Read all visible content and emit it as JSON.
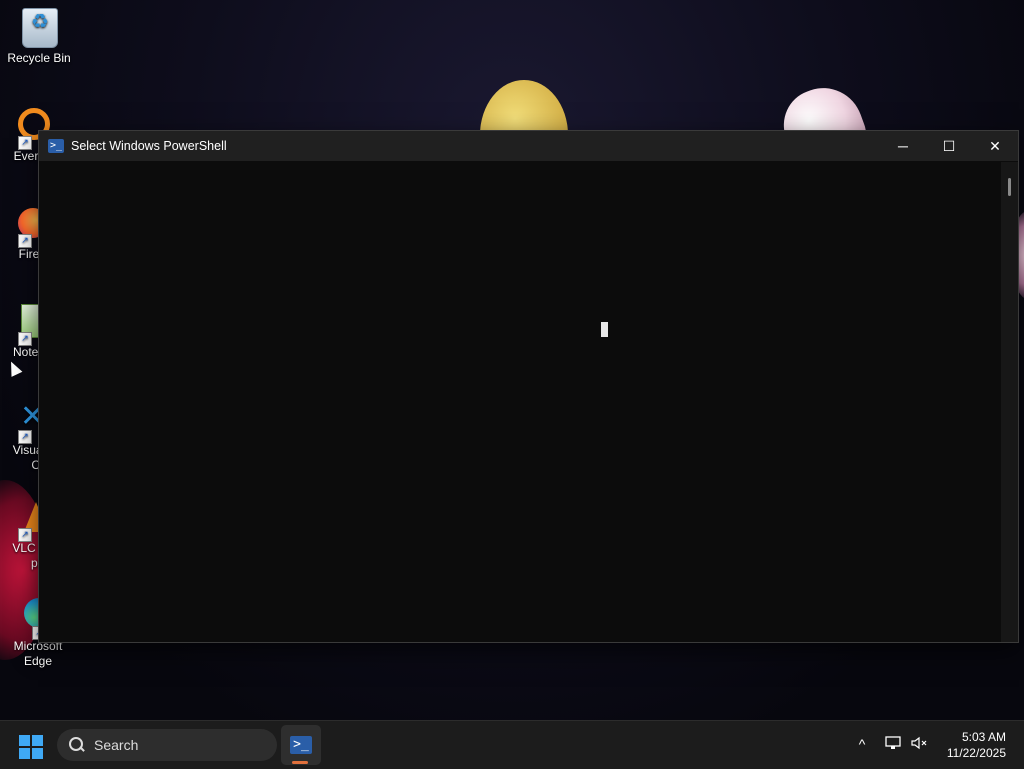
{
  "desktop": {
    "icons": [
      {
        "label": "Recycle Bin",
        "icon": "recycle-bin-icon"
      },
      {
        "label": "Every",
        "icon": "everything-icon"
      },
      {
        "label": "Fire",
        "icon": "firefox-icon"
      },
      {
        "label": "Notep",
        "icon": "notepad-plus-plus-icon"
      },
      {
        "label": "Visual",
        "label2": "Co",
        "icon": "vscode-icon"
      },
      {
        "label": "VLC n",
        "label2": "pla",
        "icon": "vlc-icon"
      },
      {
        "label": "Microsoft",
        "label2": "Edge",
        "icon": "edge-icon"
      }
    ]
  },
  "window": {
    "title": "Select Windows PowerShell",
    "buttons": {
      "minimize": "─",
      "maximize": "☐",
      "close": "✕"
    }
  },
  "taskbar": {
    "search_placeholder": "Search",
    "apps": [
      {
        "name": "Windows PowerShell",
        "active": true
      }
    ],
    "time": "5:03 AM",
    "date": "11/22/2025",
    "tray": {
      "chevron": "^"
    }
  },
  "colors": {
    "accent": "#3fa9f5",
    "terminal_bg": "#0c0c0c",
    "titlebar_bg": "#202020",
    "active_indicator": "#e0703c"
  }
}
